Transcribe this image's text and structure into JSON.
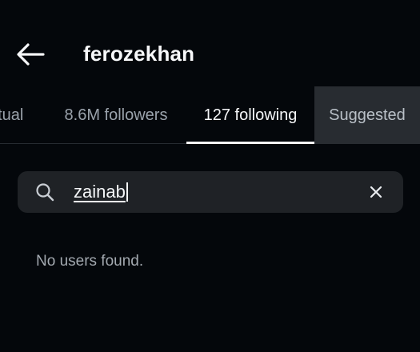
{
  "header": {
    "back_icon": "arrow-left-icon",
    "title": "ferozekhan"
  },
  "tabs": [
    {
      "label": "utual",
      "selected": false
    },
    {
      "label": "8.6M followers",
      "selected": false
    },
    {
      "label": "127 following",
      "selected": true
    },
    {
      "label": "Suggested",
      "selected": false
    }
  ],
  "search": {
    "icon": "search-icon",
    "value": "zainab",
    "clear_icon": "close-icon"
  },
  "results": {
    "empty_message": "No users found."
  },
  "colors": {
    "background": "#04070b",
    "search_field": "#1f2226",
    "active_tab": "#f6f7f9",
    "inactive_tab": "#9aa2ab",
    "suggested_tab_bg": "#282c31"
  }
}
